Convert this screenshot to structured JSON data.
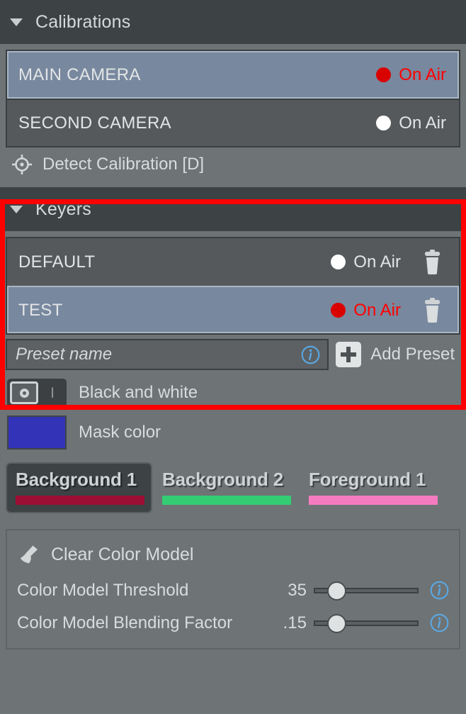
{
  "colors": {
    "panel_bg": "#6e7375",
    "header_bg": "#3d4244",
    "row_bg": "#55595b",
    "row_selected_bg": "#78889e",
    "on_air_live": "#ff0000",
    "on_air_idle": "#e2e5e6",
    "highlight_box": "#ff0000",
    "mask_color": "#3333b8",
    "background1_bar": "#9c0e33",
    "background2_bar": "#34cd74",
    "foreground1_bar": "#f47bc0",
    "info_icon": "#5aa9e6"
  },
  "calibrations": {
    "title": "Calibrations",
    "expanded": true,
    "caret_icon": "triangle-down-icon",
    "rows": [
      {
        "name": "MAIN CAMERA",
        "on_air_label": "On Air",
        "live": true,
        "selected": true
      },
      {
        "name": "SECOND CAMERA",
        "on_air_label": "On Air",
        "live": false,
        "selected": false
      }
    ],
    "detect": {
      "label": "Detect Calibration [D]",
      "icon": "crosshair-target-icon"
    }
  },
  "keyers": {
    "title": "Keyers",
    "expanded": true,
    "caret_icon": "triangle-down-icon",
    "highlighted": true,
    "rows": [
      {
        "name": "DEFAULT",
        "on_air_label": "On Air",
        "live": false,
        "selected": false,
        "delete_icon": "trash-icon"
      },
      {
        "name": "TEST",
        "on_air_label": "On Air",
        "live": true,
        "selected": true,
        "delete_icon": "trash-icon"
      }
    ],
    "preset_input": {
      "placeholder": "Preset name",
      "value": "",
      "info_icon": "info-circle-icon"
    },
    "add_preset": {
      "label": "Add Preset",
      "icon": "plus-square-icon"
    }
  },
  "options": {
    "black_and_white": {
      "label": "Black and white",
      "state": "off",
      "off_glyph": "O",
      "on_glyph": "I"
    },
    "mask_color": {
      "label": "Mask color",
      "value": "#3333b8"
    }
  },
  "layers": [
    {
      "label": "Background 1",
      "bar_color": "#9c0e33",
      "active": true
    },
    {
      "label": "Background 2",
      "bar_color": "#34cd74",
      "active": false
    },
    {
      "label": "Foreground 1",
      "bar_color": "#f47bc0",
      "active": false
    }
  ],
  "color_model": {
    "clear": {
      "label": "Clear Color Model",
      "icon": "broom-icon"
    },
    "sliders": [
      {
        "label": "Color Model Threshold",
        "value": "35",
        "fraction": 0.16,
        "info_icon": "info-circle-icon"
      },
      {
        "label": "Color Model Blending Factor",
        "value": ".15",
        "fraction": 0.16,
        "info_icon": "info-circle-icon"
      }
    ]
  }
}
